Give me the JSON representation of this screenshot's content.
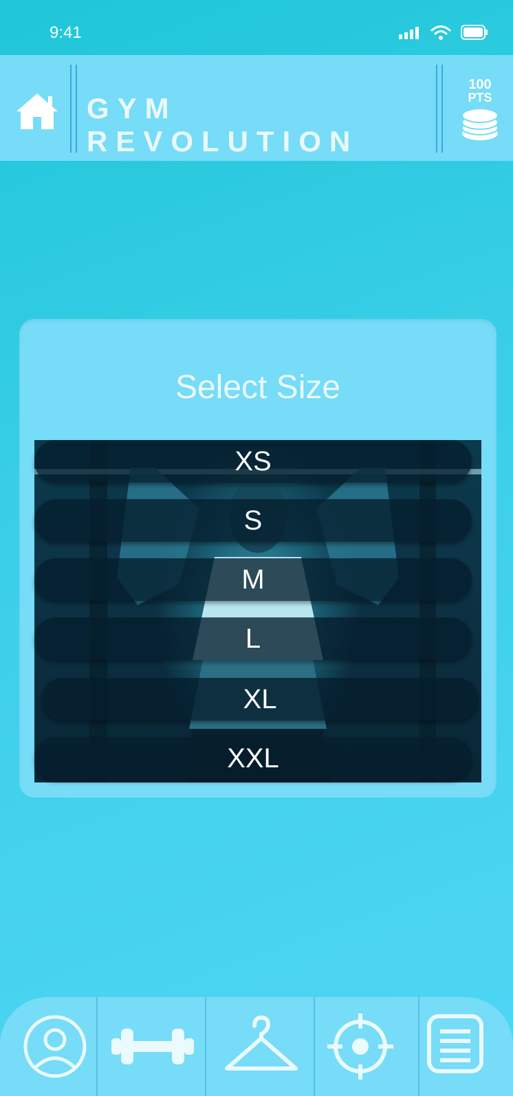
{
  "status": {
    "time": "9:41"
  },
  "header": {
    "title": "GYM REVOLUTION",
    "points_value": "100",
    "points_unit": "PTS"
  },
  "size_picker": {
    "title": "Select Size",
    "options": [
      "XS",
      "S",
      "M",
      "L",
      "XL",
      "XXL"
    ]
  },
  "tabs": [
    "profile",
    "workouts",
    "clothing",
    "goals",
    "menu"
  ],
  "icons": [
    "home-icon",
    "coins-icon",
    "signal-icon",
    "wifi-icon",
    "battery-icon",
    "profile-icon",
    "dumbbell-icon",
    "hanger-icon",
    "target-icon",
    "menu-icon"
  ],
  "colors": {
    "accent": "#76dcf7",
    "background": "#3ccfe9",
    "option_bg": "#051e2d",
    "text_light": "#eaf9ff"
  }
}
